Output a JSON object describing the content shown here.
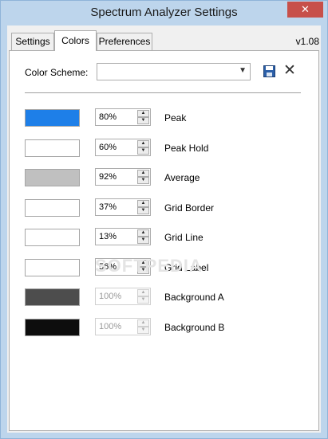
{
  "window": {
    "title": "Spectrum Analyzer Settings",
    "close_glyph": "✕"
  },
  "tabs": [
    {
      "label": "Settings"
    },
    {
      "label": "Colors",
      "active": true
    },
    {
      "label": "Preferences"
    }
  ],
  "version": "v1.08",
  "color_scheme": {
    "label": "Color Scheme:",
    "value": ""
  },
  "rows": [
    {
      "color": "#1e7fe8",
      "value": "80%",
      "label": "Peak",
      "enabled": true
    },
    {
      "color": "#ffffff",
      "value": "60%",
      "label": "Peak Hold",
      "enabled": true
    },
    {
      "color": "#c0c0c0",
      "value": "92%",
      "label": "Average",
      "enabled": true
    },
    {
      "color": "#ffffff",
      "value": "37%",
      "label": "Grid Border",
      "enabled": true
    },
    {
      "color": "#ffffff",
      "value": "13%",
      "label": "Grid Line",
      "enabled": true
    },
    {
      "color": "#ffffff",
      "value": "56%",
      "label": "Grid Label",
      "enabled": true
    },
    {
      "color": "#4d4d4d",
      "value": "100%",
      "label": "Background A",
      "enabled": false
    },
    {
      "color": "#0d0d0d",
      "value": "100%",
      "label": "Background B",
      "enabled": false
    }
  ],
  "watermark": "SOFTPEDIA"
}
